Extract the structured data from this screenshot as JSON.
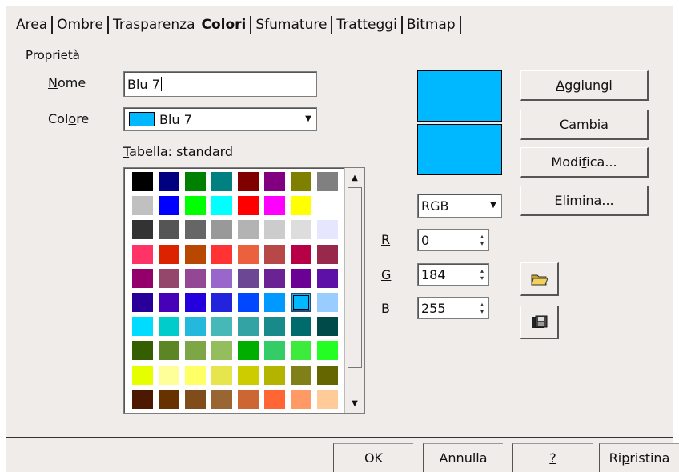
{
  "tabs": [
    "Area",
    "Ombre",
    "Trasparenza",
    "Colori",
    "Sfumature",
    "Tratteggi",
    "Bitmap"
  ],
  "active_tab": "Colori",
  "group_label": "Proprietà",
  "name_label": {
    "u": "N",
    "rest": "ome"
  },
  "name_value": "Blu 7",
  "color_label": {
    "pre": "Col",
    "u": "o",
    "rest": "re"
  },
  "color_value": "Blu 7",
  "table_label": {
    "u": "T",
    "rest": "abella: standard"
  },
  "colors": [
    "#000000",
    "#000080",
    "#008000",
    "#008080",
    "#800000",
    "#800080",
    "#808000",
    "#808080",
    "#c0c0c0",
    "#0000ff",
    "#00ff00",
    "#00ffff",
    "#ff0000",
    "#ff00ff",
    "#ffff00",
    "#ffffff",
    "#333333",
    "#555555",
    "#666666",
    "#999999",
    "#b3b3b3",
    "#cccccc",
    "#dddddd",
    "#e6e6ff",
    "#ff3366",
    "#dc2300",
    "#b84700",
    "#ff3333",
    "#eb613d",
    "#b84747",
    "#b80047",
    "#99284d",
    "#94006b",
    "#94476b",
    "#944794",
    "#9966cc",
    "#6b4794",
    "#6b2394",
    "#6b0094",
    "#5e11a6",
    "#280099",
    "#4700b8",
    "#2300dc",
    "#2323dc",
    "#0047ff",
    "#0099ff",
    "#00b8ff",
    "#99ccff",
    "#00dcff",
    "#00cccc",
    "#23b8dc",
    "#47b8b8",
    "#33a3a3",
    "#198a8a",
    "#006b6b",
    "#004a4a",
    "#355e00",
    "#5c8526",
    "#7da647",
    "#94bd5e",
    "#00ae00",
    "#33cc66",
    "#3deb3d",
    "#23ff23",
    "#e6ff00",
    "#ffff99",
    "#ffff66",
    "#e6e64c",
    "#cccc00",
    "#b3b300",
    "#808019",
    "#666600",
    "#4c1900",
    "#663300",
    "#804c19",
    "#996633",
    "#cc6633",
    "#ff6633",
    "#ff9966",
    "#ffcc99"
  ],
  "selected_index": 46,
  "color_model": "RGB",
  "r_label": "R",
  "g_label": "G",
  "b_label": "B",
  "r_value": "0",
  "g_value": "184",
  "b_value": "255",
  "preview_color": "#00b8ff",
  "buttons": {
    "add": {
      "u": "A",
      "rest": "ggiungi"
    },
    "change": {
      "u": "C",
      "rest": "ambia"
    },
    "modify": {
      "pre": "Modi",
      "u": "f",
      "rest": "ica..."
    },
    "delete": {
      "u": "E",
      "rest": "limina..."
    }
  },
  "icons": {
    "open": "open-folder-icon",
    "save": "save-icon"
  },
  "bottom": {
    "ok": "OK",
    "cancel": "Annulla",
    "help": "?",
    "reset": {
      "pre": "Ri",
      "u": "p",
      "rest": "ristina"
    }
  }
}
